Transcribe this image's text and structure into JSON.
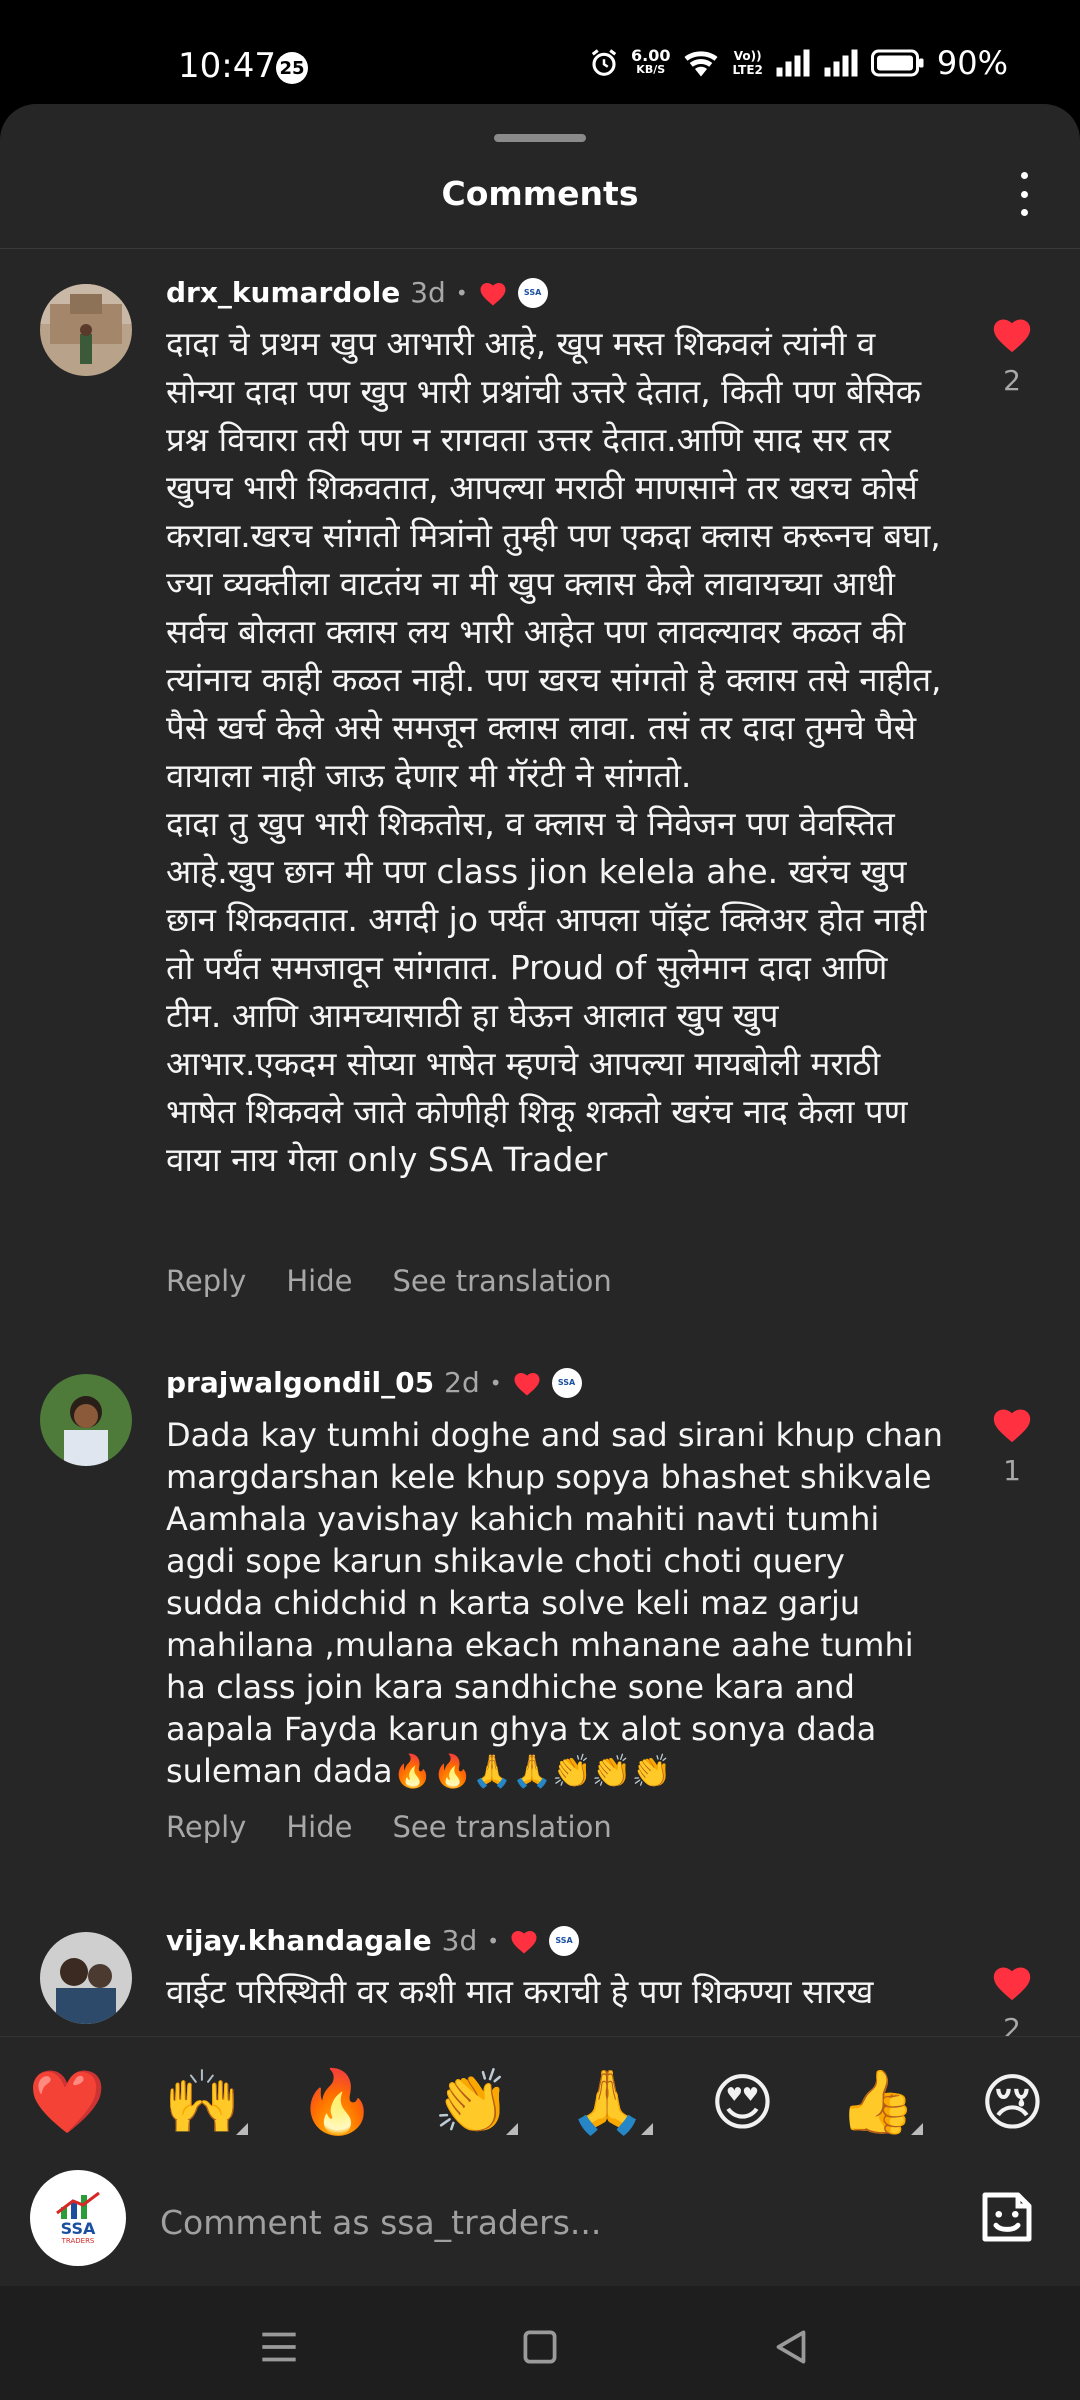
{
  "status_bar": {
    "time": "10:47",
    "notification_count": "25",
    "network_speed_value": "6.00",
    "network_speed_unit": "KB/S",
    "volte_label_top": "Vo))",
    "volte_label_bottom": "LTE2",
    "battery_percent": "90%"
  },
  "sheet": {
    "title": "Comments"
  },
  "comments": [
    {
      "username": "drx_kumardole",
      "time": "3d",
      "text": "दादा चे प्रथम खुप आभारी आहे, खूप मस्त शिकवलं त्यांनी व सोन्या दादा पण खुप भारी प्रश्नांची उत्तरे देतात, किती पण बेसिक प्रश्न विचारा तरी पण न रागवता उत्तर देतात.आणि साद सर तर खुपच भारी शिकवतात, आपल्या मराठी माणसाने तर खरच कोर्स करावा.खरच सांगतो मित्रांनो तुम्ही पण एकदा क्लास करूनच बघा, ज्या व्यक्तीला वाटतंय ना मी खुप क्लास केले लावायच्या आधी सर्वच बोलता क्लास लय भारी आहेत पण लावल्यावर कळत की त्यांनाच काही कळत नाही. पण खरच सांगतो हे क्लास तसे नाहीत, पैसे खर्च केले असे समजून क्लास लावा. तसं तर दादा तुमचे पैसे वायाला नाही जाऊ देणार मी गॅरंटी ने सांगतो.\nदादा तु खुप भारी शिकतोस, व क्लास चे निवेजन पण वेवस्तित आहे.खुप छान मी पण class jion kelela ahe. खरंच खुप छान शिकवतात. अगदी jo पर्यंत आपला पॉइंट क्लिअर होत नाही तो पर्यंत समजावून सांगतात. Proud of सुलेमान दादा आणि टीम. आणि आमच्यासाठी हा घेऊन आलात खुप खुप आभार.एकदम सोप्या भाषेत म्हणचे आपल्या मायबोली मराठी भाषेत शिकवले जाते कोणीही शिकू शकतो खरंच नाद केला पण वाया नाय गेला only SSA Trader",
      "likes": "2",
      "reply": "Reply",
      "hide": "Hide",
      "translate": "See translation"
    },
    {
      "username": "prajwalgondil_05",
      "time": "2d",
      "text": "Dada kay tumhi doghe and sad sirani khup chan margdarshan kele khup sopya bhashet shikvale Aamhala yavishay kahich mahiti navti tumhi agdi sope karun shikavle choti choti query sudda chidchid n karta solve keli maz garju mahilana ,mulana ekach mhanane aahe tumhi ha class join kara sandhiche sone kara and aapala Fayda karun ghya tx alot sonya dada suleman dada🔥🔥🙏🙏👏👏👏",
      "likes": "1",
      "reply": "Reply",
      "hide": "Hide",
      "translate": "See translation"
    },
    {
      "username": "vijay.khandagale",
      "time": "3d",
      "text": "वाईट परिस्थिती वर कशी मात कराची हे पण शिकण्या सारख",
      "likes": "2"
    }
  ],
  "reactions": [
    "❤️",
    "🙌",
    "🔥",
    "👏",
    "🙏",
    "😍",
    "👍",
    "😢"
  ],
  "composer": {
    "placeholder": "Comment as ssa_traders...",
    "avatar_brand": "SSA",
    "avatar_sub": "TRADERS"
  },
  "icons": {
    "heart_color": "#ff3040",
    "accent_blue": "#1a4fa0"
  }
}
